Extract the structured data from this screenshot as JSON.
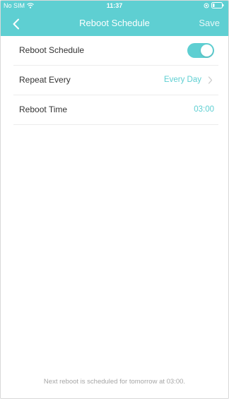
{
  "status_bar": {
    "carrier": "No SIM",
    "time": "11:37"
  },
  "nav": {
    "title": "Reboot Schedule",
    "save_label": "Save"
  },
  "settings": [
    {
      "label": "Reboot Schedule",
      "enabled": true
    },
    {
      "label": "Repeat Every",
      "value": "Every Day"
    },
    {
      "label": "Reboot Time",
      "value": "03:00"
    }
  ],
  "footer": {
    "note": "Next reboot is scheduled for tomorrow at 03:00."
  },
  "colors": {
    "accent": "#5ecfd2",
    "text": "#333333",
    "muted": "#a6a6a6"
  },
  "icons": [
    "wifi-icon",
    "lock-icon",
    "battery-icon",
    "chevron-left-icon",
    "chevron-right-icon"
  ]
}
